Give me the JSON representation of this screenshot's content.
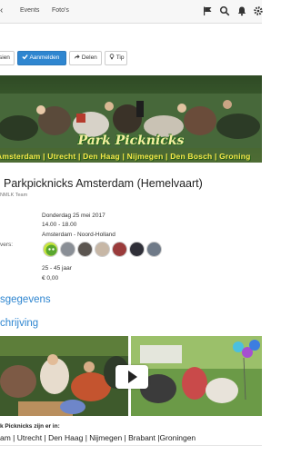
{
  "topbar": {
    "back_chevron": "‹",
    "nav": [
      "Events",
      "Foto's"
    ],
    "icons": [
      "flag-icon",
      "search-icon",
      "bell-icon",
      "gear-icon"
    ]
  },
  "actions": {
    "attend_partial": "sien",
    "register": "Aanmelden",
    "share": "Delen",
    "tip": "Tip"
  },
  "banner": {
    "logo": "Park Picknicks",
    "cities": "Amsterdam | Utrecht | Den Haag | Nijmegen | Den Bosch | Groning"
  },
  "event": {
    "title": "Parkpicknicks Amsterdam (Hemelvaart)",
    "organizer": "NMLK Team",
    "date": "Donderdag 25 mei 2017",
    "time": "14.00 - 18.00",
    "location": "Amsterdam - Noord-Holland",
    "attendees_label": "vers:",
    "age": "25 - 45 jaar",
    "price": "€ 0,00"
  },
  "sections": {
    "details": "sgegevens",
    "description": "chrijving"
  },
  "footer": {
    "title": "k Picknicks zijn er in:",
    "cities": "am  |  Utrecht  |  Den Haag  |  Nijmegen  |  Brabant  |Groningen"
  },
  "colors": {
    "accent": "#2f86d0",
    "banner_text": "#f7e84a"
  }
}
